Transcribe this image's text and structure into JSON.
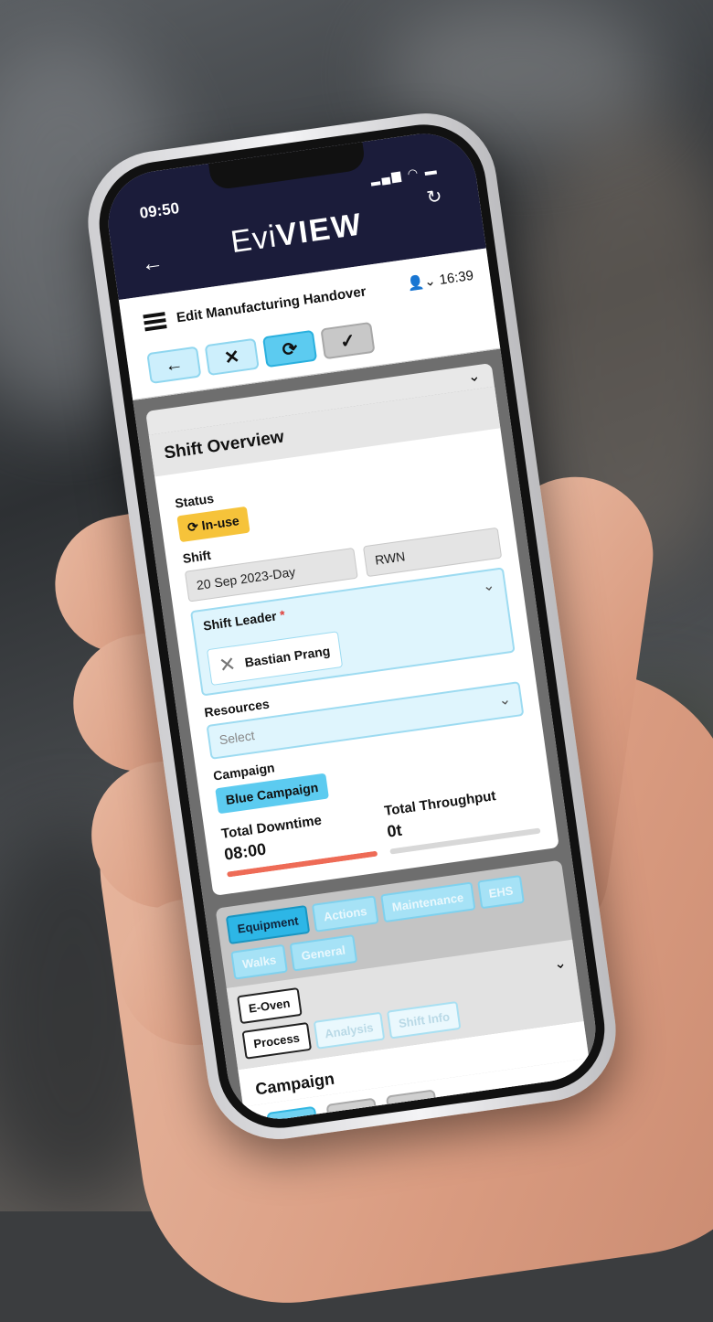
{
  "status_bar": {
    "time": "09:50",
    "signal_icons": "signal-wifi-battery"
  },
  "app": {
    "logo_part1": "Evi",
    "logo_part2": "VIEW",
    "back_glyph": "←",
    "reload_glyph": "↻",
    "clock": "16:39",
    "user_icon": "👤⌄"
  },
  "header": {
    "title": "Edit Manufacturing Handover",
    "toolbar": {
      "back": "←",
      "cancel": "✕",
      "refresh": "⟳",
      "confirm": "✓"
    }
  },
  "shift_overview": {
    "heading": "Shift Overview",
    "status_label": "Status",
    "status_value": "In-use",
    "shift_label": "Shift",
    "shift_date": "20 Sep 2023-Day",
    "shift_code": "RWN",
    "shift_leader_label": "Shift Leader",
    "required_mark": "*",
    "shift_leader_value": "Bastian Prang",
    "resources_label": "Resources",
    "resources_placeholder": "Select",
    "campaign_label": "Campaign",
    "campaign_value": "Blue Campaign",
    "total_downtime_label": "Total Downtime",
    "total_downtime_value": "08:00",
    "total_downtime_fill": 1.0,
    "total_throughput_label": "Total Throughput",
    "total_throughput_value": "0t",
    "total_throughput_fill": 0.0
  },
  "tabs": {
    "row1": [
      "Equipment",
      "Actions",
      "Maintenance",
      "EHS"
    ],
    "row2": [
      "Walks",
      "General"
    ],
    "sub_row1": [
      "E-Oven"
    ],
    "sub_row2": [
      "Process",
      "Analysis",
      "Shift Info"
    ]
  },
  "section": {
    "title": "Campaign"
  },
  "bottom_tools": {
    "expand": "⇕",
    "edit": "✎",
    "list": "☰"
  },
  "colors": {
    "header_bg": "#1b1c3a",
    "accent": "#5ccbf0",
    "status_badge": "#f6c33a",
    "downtime_bar": "#ee6b56"
  }
}
